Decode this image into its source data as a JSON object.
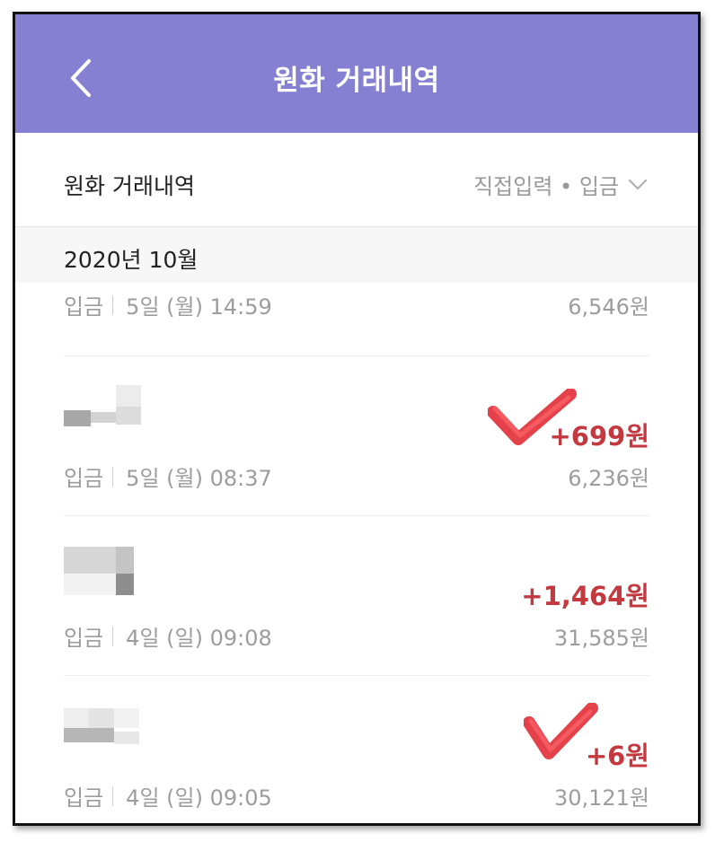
{
  "header": {
    "title": "원화 거래내역",
    "back_icon": "chevron-left-icon",
    "background": "#8580d1"
  },
  "subheader": {
    "title": "원화 거래내역",
    "filter_label": "직접입력 • 입금",
    "filter_icon": "chevron-down-icon"
  },
  "month_label": "2020년 10월",
  "transactions": [
    {
      "type": "입금",
      "date": "5일 (월) 14:59",
      "balance": "6,546원",
      "amount": ""
    },
    {
      "type": "입금",
      "date": "5일 (월) 08:37",
      "balance": "6,236원",
      "amount": "+699원"
    },
    {
      "type": "입금",
      "date": "4일 (일) 09:08",
      "balance": "31,585원",
      "amount": "+1,464원"
    },
    {
      "type": "입금",
      "date": "4일 (일) 09:05",
      "balance": "30,121원",
      "amount": "+6원"
    }
  ],
  "colors": {
    "accent": "#8580d1",
    "amount": "#c4393f",
    "check_mark": "#e0202a"
  }
}
